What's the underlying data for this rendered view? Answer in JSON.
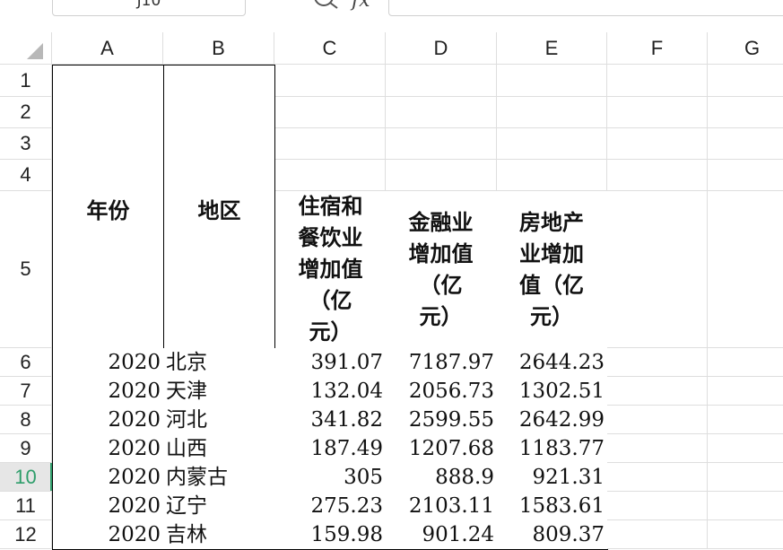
{
  "name_box": "J10",
  "formula_icon": "fx",
  "columns": [
    "A",
    "B",
    "C",
    "D",
    "E",
    "F",
    "G"
  ],
  "rows": [
    "1",
    "2",
    "3",
    "4",
    "5",
    "6",
    "7",
    "8",
    "9",
    "10",
    "11",
    "12"
  ],
  "active_row": "10",
  "headers": {
    "year": "年份",
    "region": "地区",
    "hotel": "住宿和\n餐饮业\n增加值\n（亿\n元）",
    "finance": "金融业\n增加值\n（亿\n元）",
    "realestate": "房地产\n业增加\n值（亿\n元）"
  },
  "data_rows": [
    {
      "year": "2020",
      "region": "北京",
      "hotel": "391.07",
      "finance": "7187.97",
      "realestate": "2644.23"
    },
    {
      "year": "2020",
      "region": "天津",
      "hotel": "132.04",
      "finance": "2056.73",
      "realestate": "1302.51"
    },
    {
      "year": "2020",
      "region": "河北",
      "hotel": "341.82",
      "finance": "2599.55",
      "realestate": "2642.99"
    },
    {
      "year": "2020",
      "region": "山西",
      "hotel": "187.49",
      "finance": "1207.68",
      "realestate": "1183.77"
    },
    {
      "year": "2020",
      "region": "内蒙古",
      "hotel": "305",
      "finance": "888.9",
      "realestate": "921.31"
    },
    {
      "year": "2020",
      "region": "辽宁",
      "hotel": "275.23",
      "finance": "2103.11",
      "realestate": "1583.61"
    },
    {
      "year": "2020",
      "region": "吉林",
      "hotel": "159.98",
      "finance": "901.24",
      "realestate": "809.37"
    }
  ]
}
